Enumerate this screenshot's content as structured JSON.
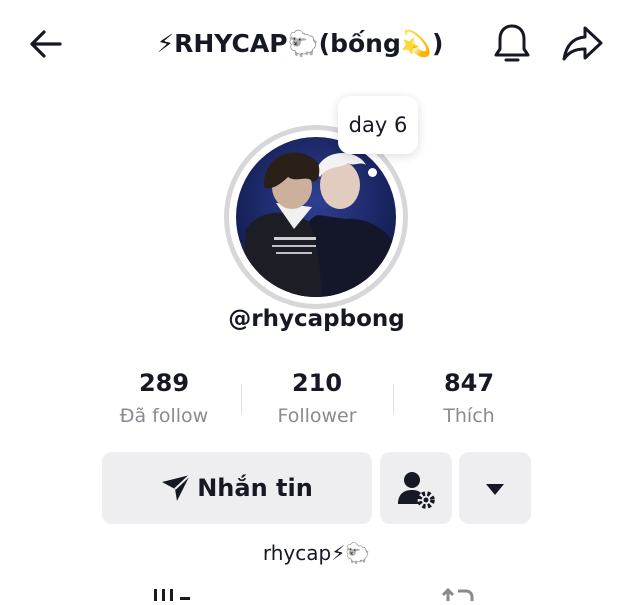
{
  "header": {
    "title": "⚡RHYCAP🐑(bống💫)",
    "icons": [
      "back-arrow-icon",
      "bell-icon",
      "share-icon"
    ]
  },
  "profile": {
    "bubble_text": "day 6",
    "username": "@rhycapbong",
    "bio": "rhycap⚡🐑"
  },
  "stats": [
    {
      "value": "289",
      "label": "Đã follow"
    },
    {
      "value": "210",
      "label": "Follower"
    },
    {
      "value": "847",
      "label": "Thích"
    }
  ],
  "actions": {
    "message_label": "Nhắn tin",
    "icons": [
      "send-icon",
      "add-friend-icon",
      "dropdown-arrow-icon"
    ]
  },
  "colors": {
    "text": "#161823",
    "secondary_text": "#8a8b91",
    "button_bg": "#eeeef0",
    "ring": "#d7d7d9",
    "accent_bolt": "#f5b400"
  }
}
